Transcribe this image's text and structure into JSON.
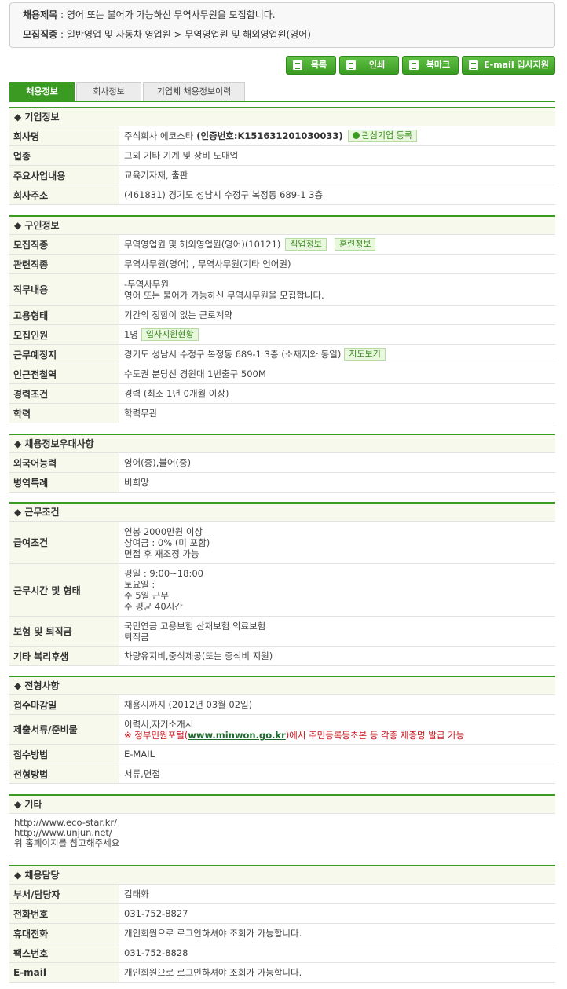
{
  "summary": {
    "title_label": "채용제목",
    "title_value": ": 영어 또는 불어가 가능하신 무역사무원을 모집합니다.",
    "job_label": "모집직종",
    "job_value": ": 일반영업 및 자동차 영업원 > 무역영업원 및 해외영업원(영어)"
  },
  "buttons": {
    "list": "목록",
    "print": "인쇄",
    "bookmark": "북마크",
    "email": "E-mail 입사지원"
  },
  "tabs": [
    "채용정보",
    "회사정보",
    "기업체 채용정보이력"
  ],
  "sections": {
    "company": {
      "header": "◆ 기업정보",
      "name_label": "회사명",
      "name_value": "주식회사 에코스타",
      "cert": "(인증번호:K151631201030033)",
      "cert_tag": "관심기업 등록",
      "industry_label": "업종",
      "industry_value": "그외 기타 기계 및 장비 도매업",
      "business_label": "주요사업내용",
      "business_value": "교육기자재, 출판",
      "address_label": "회사주소",
      "address_value": "(461831) 경기도 성남시 수정구 복정동 689-1 3층"
    },
    "recruit": {
      "header": "◆ 구인정보",
      "job_label": "모집직종",
      "job_value": "무역영업원 및 해외영업원(영어)(10121)",
      "job_tag1": "직업정보",
      "job_tag2": "훈련정보",
      "related_label": "관련직종",
      "related_value": "무역사무원(영어) , 무역사무원(기타 언어권)",
      "duty_label": "직무내용",
      "duty_line1": "-무역사무원",
      "duty_line2": "영어 또는 불어가 가능하신 무역사무원을 모집합니다.",
      "type_label": "고용형태",
      "type_value": "기간의 정함이 없는 근로계약",
      "count_label": "모집인원",
      "count_value": "1명",
      "count_tag": "입사지원현황",
      "place_label": "근무예정지",
      "place_value": "경기도 성남시 수정구 복정동 689-1 3층 (소재지와 동일)",
      "place_tag": "지도보기",
      "subway_label": "인근전철역",
      "subway_value": "수도권 분당선 경원대 1번출구 500M",
      "career_label": "경력조건",
      "career_value": "경력 (최소 1년 0개월 이상)",
      "edu_label": "학력",
      "edu_value": "학력무관"
    },
    "preference": {
      "header": "◆ 채용정보우대사항",
      "lang_label": "외국어능력",
      "lang_value": "영어(중),불어(중)",
      "military_label": "병역특례",
      "military_value": "비희망"
    },
    "conditions": {
      "header": "◆ 근무조건",
      "salary_label": "급여조건",
      "salary_line1": "연봉 2000만원 이상",
      "salary_line2": "상여금 : 0% (미 포함)",
      "salary_line3": "면접 후 재조정 가능",
      "hours_label": "근무시간 및 형태",
      "hours_line1": "평일 : 9:00~18:00",
      "hours_line2": "토요일 :",
      "hours_line3": "주 5일 근무",
      "hours_line4": "주 평균 40시간",
      "insurance_label": "보험 및 퇴직금",
      "insurance_line1": "국민연금 고용보험 산재보험 의료보험",
      "insurance_line2": "퇴직금",
      "welfare_label": "기타 복리후생",
      "welfare_value": "차량유지비,중식제공(또는 중식비 지원)"
    },
    "selection": {
      "header": "◆ 전형사항",
      "deadline_label": "접수마감일",
      "deadline_value": "채용시까지 (2012년 03월 02일)",
      "docs_label": "제출서류/준비물",
      "docs_line1": "이력서,자기소개서",
      "docs_notice_pre": "※ 정부민원포털(",
      "docs_notice_link": "www.minwon.go.kr",
      "docs_notice_post": ")에서 주민등록등초본 등 각종 제증명 발급 가능",
      "method_label": "접수방법",
      "method_value": "E-MAIL",
      "process_label": "전형방법",
      "process_value": "서류,면접"
    },
    "etc": {
      "header": "◆ 기타",
      "line1": "http://www.eco-star.kr/",
      "line2": "http://www.unjun.net/",
      "line3": "위 홈페이지를 참고해주세요"
    },
    "contact": {
      "header": "◆ 채용담당",
      "dept_label": "부서/담당자",
      "dept_value": "김태화",
      "phone_label": "전화번호",
      "phone_value": "031-752-8827",
      "mobile_label": "휴대전화",
      "mobile_value": "개인회원으로 로그인하셔야 조회가 가능합니다.",
      "fax_label": "팩스번호",
      "fax_value": "031-752-8828",
      "email_label": "E-mail",
      "email_value": "개인회원으로 로그인하셔야 조회가 가능합니다."
    }
  },
  "colors": {
    "accent_green": "#3a9a22",
    "label_bg": "#f6f9ec",
    "notice_red": "#c8171d"
  }
}
